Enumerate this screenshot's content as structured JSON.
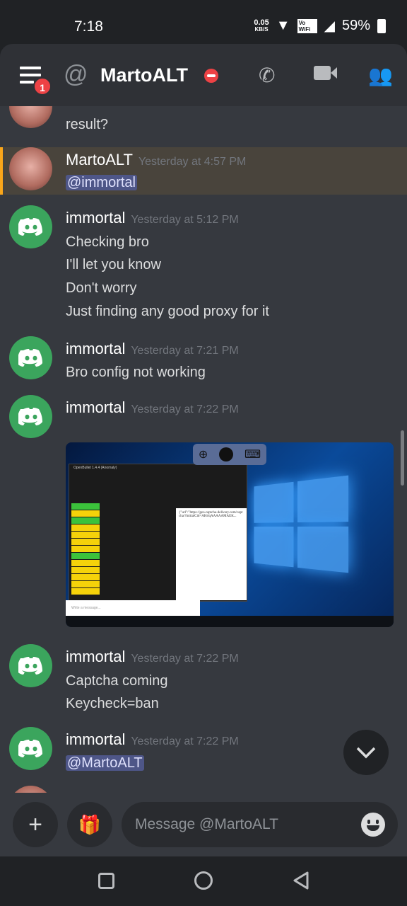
{
  "status_bar": {
    "time": "7:18",
    "net_speed": "0.05",
    "net_unit": "KB/S",
    "volte": "Vo WiFi",
    "battery": "59%"
  },
  "header": {
    "title": "MartoALT",
    "at": "@",
    "notification_count": "1",
    "status": "dnd"
  },
  "messages": [
    {
      "author": "MartoALT",
      "lines": [
        "result?"
      ],
      "partial": true
    },
    {
      "author": "MartoALT",
      "timestamp": "Yesterday at 4:57 PM",
      "mention": "@immortal",
      "highlighted": true
    },
    {
      "author": "immortal",
      "timestamp": "Yesterday at 5:12 PM",
      "lines": [
        "Checking  bro",
        "I'll  let you know",
        "Don't  worry",
        "Just finding  any good proxy for it"
      ]
    },
    {
      "author": "immortal",
      "timestamp": "Yesterday at 7:21 PM",
      "lines": [
        "Bro config not working"
      ]
    },
    {
      "author": "immortal",
      "timestamp": "Yesterday at 7:22 PM",
      "attachment": {
        "window_title": "OpenBullet 1.4.4 (Anomaly)",
        "chat_placeholder": "Write a message..."
      }
    },
    {
      "author": "immortal",
      "timestamp": "Yesterday at 7:22 PM",
      "lines": [
        "Captcha coming",
        "Keycheck=ban"
      ]
    },
    {
      "author": "immortal",
      "timestamp": "Yesterday at 7:22 PM",
      "mention": "@MartoALT"
    }
  ],
  "composer": {
    "placeholder": "Message @MartoALT"
  },
  "colors": {
    "accent": "#3ba55d",
    "dnd": "#ed4245",
    "highlight_bar": "#faa61a",
    "mention_bg": "#4e5688"
  }
}
